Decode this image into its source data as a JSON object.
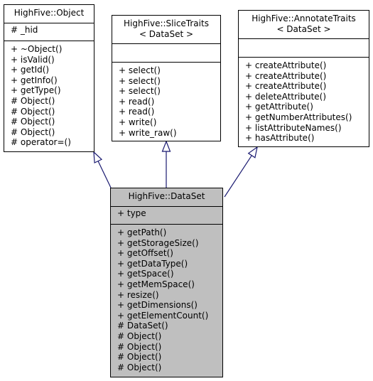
{
  "diagram": {
    "edge_color": "#191970",
    "focus_fill": "#bfbfbf",
    "classes": [
      {
        "id": "object",
        "title": [
          "HighFive::Object"
        ],
        "attributes": [
          "# _hid"
        ],
        "methods": [
          "+ ~Object()",
          "+ isValid()",
          "+ getId()",
          "+ getInfo()",
          "+ getType()",
          "# Object()",
          "# Object()",
          "# Object()",
          "# Object()",
          "# operator=()"
        ]
      },
      {
        "id": "slicetraits",
        "title": [
          "HighFive::SliceTraits",
          "< DataSet >"
        ],
        "attributes": [],
        "methods": [
          "+ select()",
          "+ select()",
          "+ select()",
          "+ read()",
          "+ read()",
          "+ write()",
          "+ write_raw()"
        ]
      },
      {
        "id": "annotatetraits",
        "title": [
          "HighFive::AnnotateTraits",
          "< DataSet >"
        ],
        "attributes": [],
        "methods": [
          "+ createAttribute()",
          "+ createAttribute()",
          "+ createAttribute()",
          "+ deleteAttribute()",
          "+ getAttribute()",
          "+ getNumberAttributes()",
          "+ listAttributeNames()",
          "+ hasAttribute()"
        ]
      },
      {
        "id": "dataset",
        "title": [
          "HighFive::DataSet"
        ],
        "attributes": [
          "+ type"
        ],
        "methods": [
          "+ getPath()",
          "+ getStorageSize()",
          "+ getOffset()",
          "+ getDataType()",
          "+ getSpace()",
          "+ getMemSpace()",
          "+ resize()",
          "+ getDimensions()",
          "+ getElementCount()",
          "# DataSet()",
          "# Object()",
          "# Object()",
          "# Object()",
          "# Object()"
        ]
      }
    ],
    "edges": [
      {
        "from": "dataset",
        "to": "object",
        "type": "inheritance"
      },
      {
        "from": "dataset",
        "to": "slicetraits",
        "type": "inheritance"
      },
      {
        "from": "dataset",
        "to": "annotatetraits",
        "type": "inheritance"
      }
    ]
  }
}
